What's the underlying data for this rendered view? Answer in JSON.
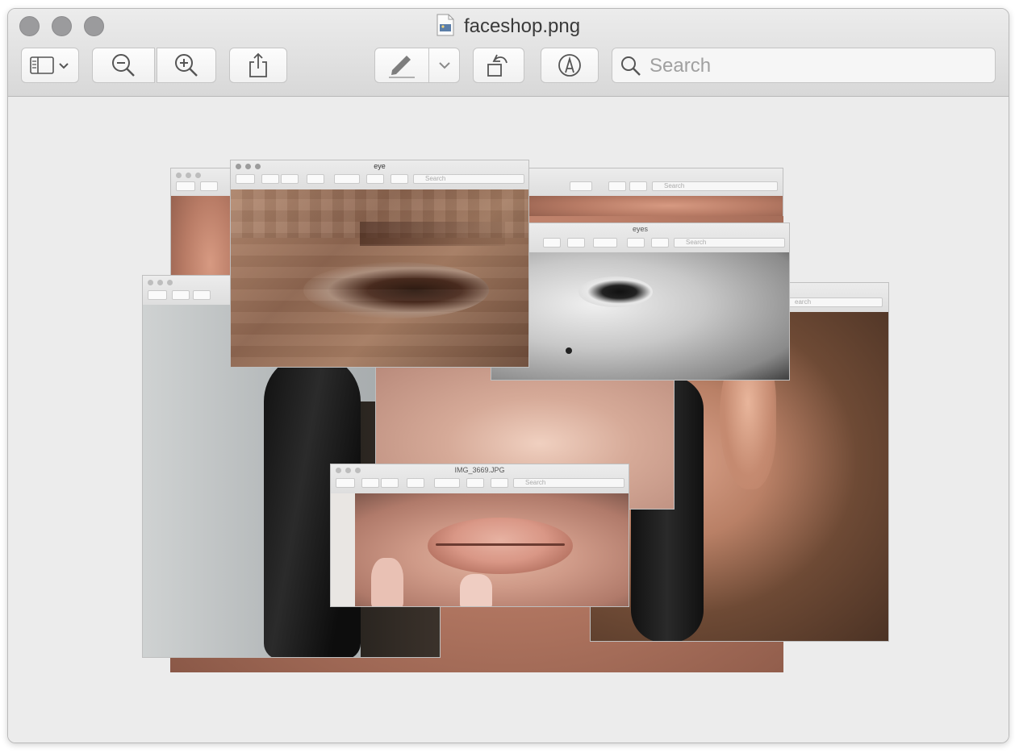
{
  "window": {
    "title": "faceshop.png",
    "traffic_lights": [
      "close",
      "minimize",
      "zoom"
    ]
  },
  "toolbar": {
    "buttons": [
      {
        "name": "sidebar-view-button",
        "icon": "sidebar-icon"
      },
      {
        "name": "zoom-out-button",
        "icon": "zoom-out-icon"
      },
      {
        "name": "zoom-in-button",
        "icon": "zoom-in-icon"
      },
      {
        "name": "share-button",
        "icon": "share-icon"
      },
      {
        "name": "markup-pen-button",
        "icon": "pen-icon"
      },
      {
        "name": "markup-dropdown-button",
        "icon": "chevron-down-icon"
      },
      {
        "name": "rotate-button",
        "icon": "rotate-icon"
      },
      {
        "name": "markup-toolbar-button",
        "icon": "markup-circle-icon"
      }
    ],
    "search_placeholder": "Search"
  },
  "collage": {
    "windows": [
      {
        "id": "eye",
        "title": "eye",
        "search": "Search"
      },
      {
        "id": "eyes",
        "title": "eyes",
        "search": "Search"
      },
      {
        "id": "lips",
        "title": "IMG_3669.JPG",
        "search": "Search"
      },
      {
        "id": "ear",
        "title": "",
        "search": "earch"
      },
      {
        "id": "top-right",
        "title": "",
        "search": "Search"
      }
    ]
  }
}
